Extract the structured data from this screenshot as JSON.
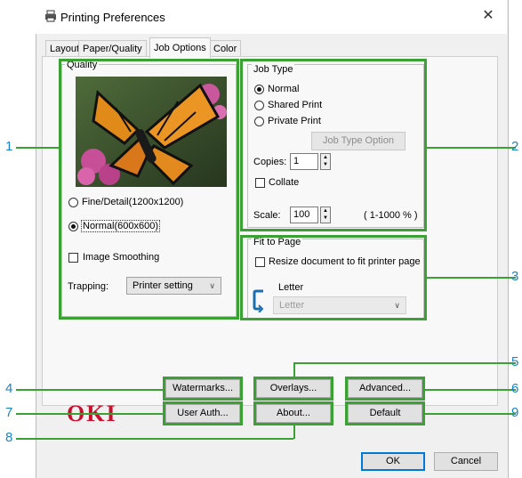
{
  "window": {
    "title": "Printing Preferences",
    "close_glyph": "✕"
  },
  "tabs": [
    "Layout",
    "Paper/Quality",
    "Job Options",
    "Color"
  ],
  "quality": {
    "legend": "Quality",
    "fine_label": "Fine/Detail(1200x1200)",
    "normal_label": "Normal(600x600)",
    "selected": "Normal(600x600)",
    "image_smoothing_label": "Image Smoothing",
    "image_smoothing_checked": false,
    "trapping_label": "Trapping:",
    "trapping_value": "Printer setting"
  },
  "job_type": {
    "legend": "Job Type",
    "options": [
      "Normal",
      "Shared Print",
      "Private Print"
    ],
    "selected": "Normal",
    "option_button": "Job Type Option",
    "copies_label": "Copies:",
    "copies_value": "1",
    "collate_label": "Collate",
    "collate_checked": false,
    "scale_label": "Scale:",
    "scale_value": "100",
    "scale_range": "( 1-1000 % )"
  },
  "fit_to_page": {
    "legend": "Fit to Page",
    "resize_label": "Resize document to fit printer page",
    "resize_checked": false,
    "paper_label": "Letter",
    "paper_select": "Letter"
  },
  "buttons": {
    "watermarks": "Watermarks...",
    "overlays": "Overlays...",
    "advanced": "Advanced...",
    "user_auth": "User Auth...",
    "about": "About...",
    "default": "Default",
    "ok": "OK",
    "cancel": "Cancel"
  },
  "brand": {
    "logo_text": "OKI",
    "logo_color": "#c8102e"
  },
  "callouts": [
    "1",
    "2",
    "3",
    "4",
    "5",
    "6",
    "7",
    "8",
    "9"
  ],
  "colors": {
    "highlight": "#3ba135",
    "callout_number": "#1a85c6",
    "primary_border": "#0078d7"
  },
  "icons": {
    "printer": "printer-icon",
    "paper_orientation": "paper-orientation-icon",
    "butterfly": "butterfly-preview"
  }
}
